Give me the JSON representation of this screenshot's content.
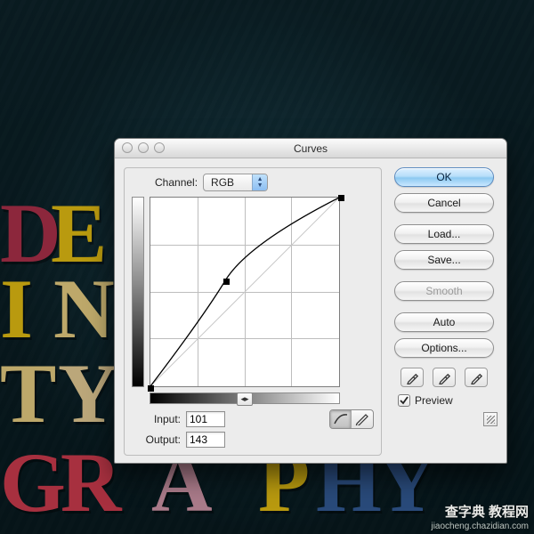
{
  "dialog": {
    "title": "Curves",
    "channel_label": "Channel:",
    "channel_value": "RGB",
    "input_label": "Input:",
    "input_value": "101",
    "output_label": "Output:",
    "output_value": "143",
    "hmarker": "◂▸"
  },
  "buttons": {
    "ok": "OK",
    "cancel": "Cancel",
    "load": "Load...",
    "save": "Save...",
    "smooth": "Smooth",
    "auto": "Auto",
    "options": "Options..."
  },
  "preview": {
    "label": "Preview"
  },
  "chart_data": {
    "type": "line",
    "title": "Curves",
    "xlabel": "Input",
    "ylabel": "Output",
    "xlim": [
      0,
      255
    ],
    "ylim": [
      0,
      255
    ],
    "series": [
      {
        "name": "RGB",
        "points": [
          {
            "x": 0,
            "y": 0
          },
          {
            "x": 101,
            "y": 143
          },
          {
            "x": 255,
            "y": 255
          }
        ]
      }
    ],
    "selected_point": {
      "x": 101,
      "y": 143
    },
    "grid": true
  },
  "watermark": {
    "zh": "查字典 教程网",
    "url": "jiaocheng.chazidian.com"
  }
}
